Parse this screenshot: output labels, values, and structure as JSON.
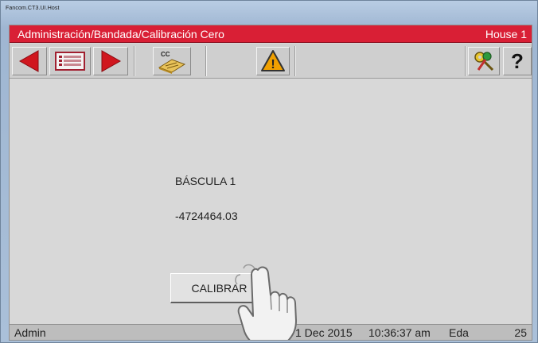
{
  "window": {
    "title": "Fancom.CT3.UI.Host"
  },
  "header": {
    "breadcrumb": "Administración/Bandada/Calibración Cero",
    "house": "House 1"
  },
  "toolbar": {
    "prev_icon": "arrow-left-icon",
    "list_icon": "list-icon",
    "next_icon": "arrow-right-icon",
    "calibrate_icon": "cc-calibration-icon",
    "calibrate_icon_text": "CC",
    "alarm_icon": "warning-icon",
    "alarm_symbol": "!",
    "keys_icon": "keys-icon",
    "help_label": "?"
  },
  "main": {
    "scale_label": "BÁSCULA 1",
    "scale_value": "-4724464.03",
    "calibrate_button": "CALIBRAR"
  },
  "status": {
    "user": "Admin",
    "date": "1 Dec 2015",
    "time": "10:36:37 am",
    "age_label": "Eda",
    "age_value": "25"
  },
  "colors": {
    "title_bar": "#d91f35",
    "arrow_red": "#d0161e",
    "warning_orange": "#f0a000",
    "background": "#d8d8d8"
  }
}
